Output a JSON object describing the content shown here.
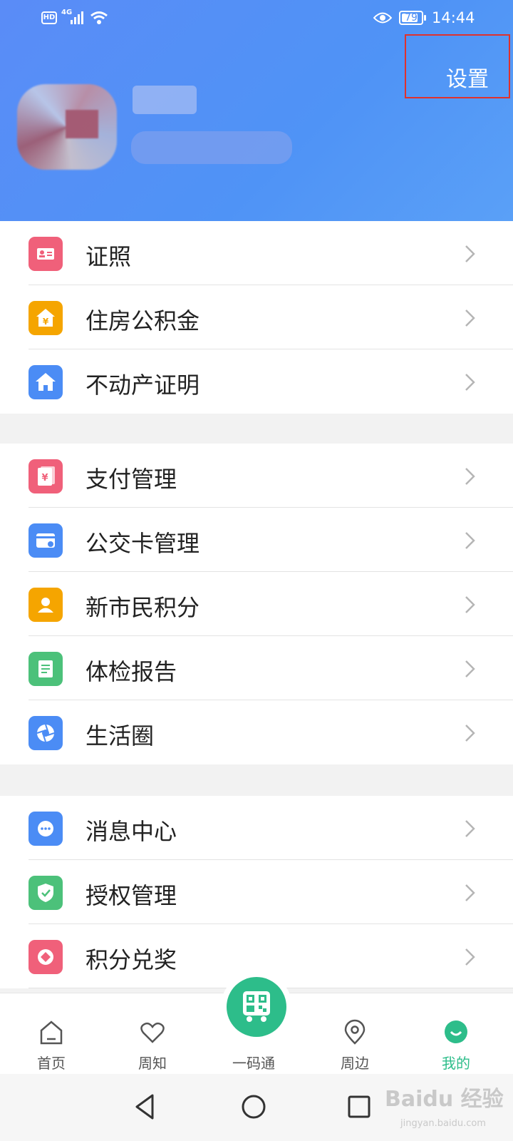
{
  "status_bar": {
    "hd_badge": "HD",
    "network": "4G",
    "battery": "79",
    "time": "14:44"
  },
  "header": {
    "settings_label": "设置"
  },
  "menu_groups": [
    {
      "items": [
        {
          "label": "证照",
          "icon": "id-card-icon",
          "color": "#f0607a"
        },
        {
          "label": "住房公积金",
          "icon": "housing-fund-icon",
          "color": "#f5a500"
        },
        {
          "label": "不动产证明",
          "icon": "house-icon",
          "color": "#4b8cf5"
        }
      ]
    },
    {
      "items": [
        {
          "label": "支付管理",
          "icon": "payment-icon",
          "color": "#f0607a"
        },
        {
          "label": "公交卡管理",
          "icon": "bus-card-icon",
          "color": "#4b8cf5"
        },
        {
          "label": "新市民积分",
          "icon": "person-badge-icon",
          "color": "#f5a500"
        },
        {
          "label": "体检报告",
          "icon": "report-icon",
          "color": "#4cc17a"
        },
        {
          "label": "生活圈",
          "icon": "aperture-icon",
          "color": "#4b8cf5"
        }
      ]
    },
    {
      "items": [
        {
          "label": "消息中心",
          "icon": "message-icon",
          "color": "#4b8cf5"
        },
        {
          "label": "授权管理",
          "icon": "shield-check-icon",
          "color": "#4cc17a"
        },
        {
          "label": "积分兑奖",
          "icon": "reward-icon",
          "color": "#f0607a"
        }
      ]
    }
  ],
  "tabbar": {
    "tabs": [
      {
        "label": "首页",
        "icon": "home-icon",
        "active": false
      },
      {
        "label": "周知",
        "icon": "heart-icon",
        "active": false
      },
      {
        "label": "一码通",
        "icon": "qr-bus-icon",
        "active": false
      },
      {
        "label": "周边",
        "icon": "location-pin-icon",
        "active": false
      },
      {
        "label": "我的",
        "icon": "profile-smile-icon",
        "active": true
      }
    ],
    "active_color": "#2dbd8a"
  },
  "watermark": {
    "main": "Baidu 经验",
    "sub": "jingyan.baidu.com"
  }
}
